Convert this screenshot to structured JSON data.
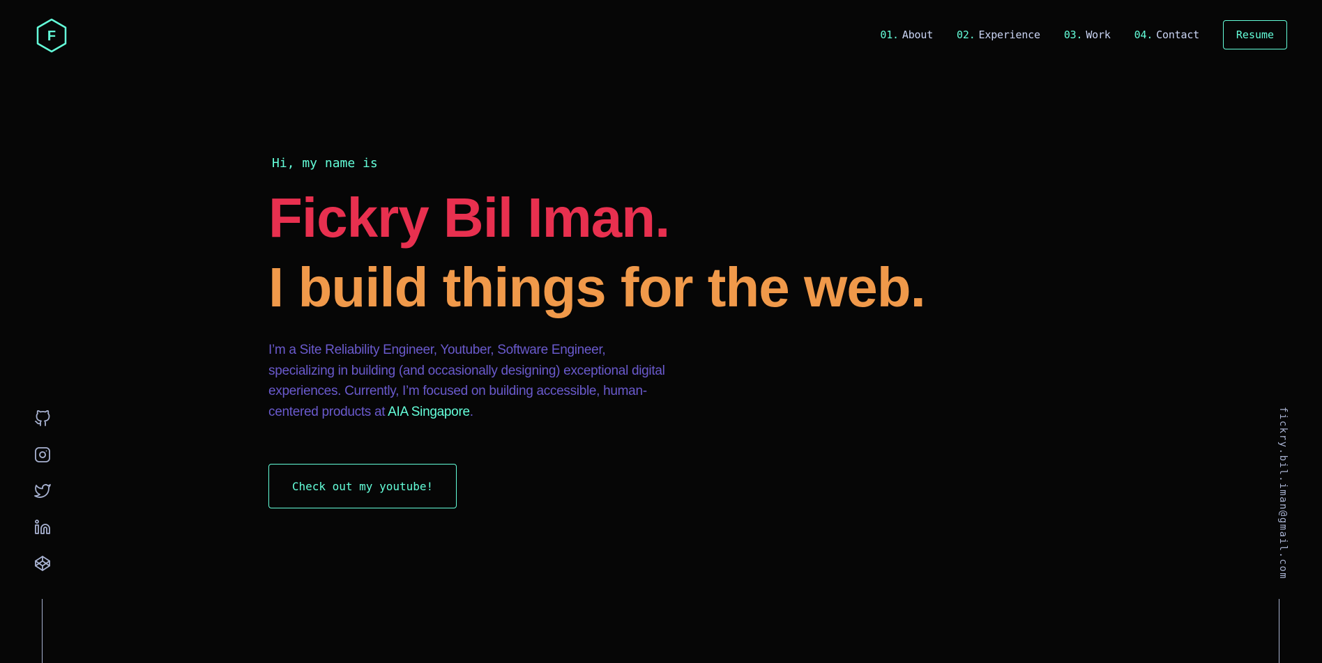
{
  "header": {
    "logo_letter": "F",
    "nav": [
      {
        "num": "01.",
        "label": "About"
      },
      {
        "num": "02.",
        "label": "Experience"
      },
      {
        "num": "03.",
        "label": "Work"
      },
      {
        "num": "04.",
        "label": "Contact"
      }
    ],
    "resume_label": "Resume"
  },
  "hero": {
    "greeting": "Hi, my name is",
    "name": "Fickry Bil Iman.",
    "tagline": "I build things for the web.",
    "bio_text": "I’m a Site Reliability Engineer, Youtuber, Software Engineer, specializing in building (and occasionally designing) exceptional digital experiences. Currently, I’m focused on building accessible, human-centered products at ",
    "bio_company": "AIA Singapore",
    "bio_end": ".",
    "cta_label": "Check out my youtube!"
  },
  "social": {
    "icons": [
      "github-icon",
      "instagram-icon",
      "twitter-icon",
      "linkedin-icon",
      "codepen-icon"
    ]
  },
  "email": "fickry.bil.iman@gmail.com",
  "colors": {
    "background": "#060606",
    "accent": "#64ffda",
    "name": "#e8304f",
    "tagline": "#f0994a",
    "bio": "#6a5acd",
    "light_text": "#ccd6f6",
    "slate": "#a8b2d1"
  }
}
